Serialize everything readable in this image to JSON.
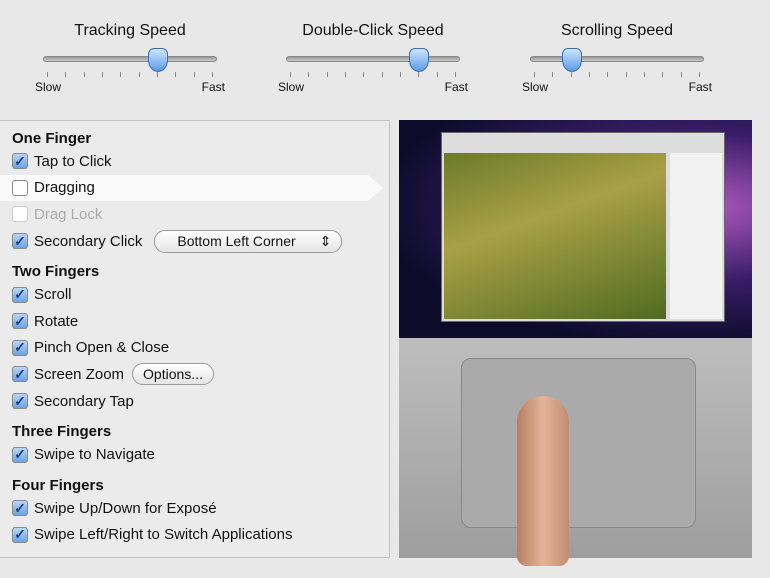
{
  "sliders": [
    {
      "title": "Tracking Speed",
      "min_label": "Slow",
      "max_label": "Fast",
      "value": 0.66
    },
    {
      "title": "Double-Click Speed",
      "min_label": "Slow",
      "max_label": "Fast",
      "value": 0.77
    },
    {
      "title": "Scrolling Speed",
      "min_label": "Slow",
      "max_label": "Fast",
      "value": 0.24
    }
  ],
  "sections": {
    "one_finger": {
      "title": "One Finger",
      "tap_to_click": "Tap to Click",
      "dragging": "Dragging",
      "drag_lock": "Drag Lock",
      "secondary_click": "Secondary Click",
      "secondary_click_option": "Bottom Left Corner"
    },
    "two_fingers": {
      "title": "Two Fingers",
      "scroll": "Scroll",
      "rotate": "Rotate",
      "pinch": "Pinch Open & Close",
      "screen_zoom": "Screen Zoom",
      "options": "Options...",
      "secondary_tap": "Secondary Tap"
    },
    "three_fingers": {
      "title": "Three Fingers",
      "swipe": "Swipe to Navigate"
    },
    "four_fingers": {
      "title": "Four Fingers",
      "expose": "Swipe Up/Down for Exposé",
      "switch": "Swipe Left/Right to Switch Applications"
    }
  }
}
